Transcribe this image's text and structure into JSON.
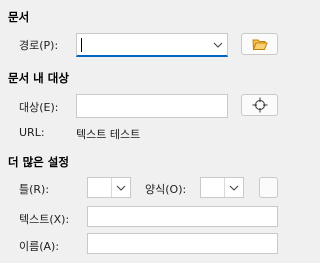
{
  "sections": {
    "document": "문서",
    "target_in_document": "문서 내 대상",
    "further_settings": "더 많은 설정"
  },
  "path": {
    "label": "경로(P):",
    "value": ""
  },
  "target": {
    "label": "대상(E):",
    "value": ""
  },
  "url": {
    "label": "URL:",
    "value": "텍스트 테스트"
  },
  "frame": {
    "label": "틀(R):",
    "value": ""
  },
  "form": {
    "label": "양식(O):",
    "value": ""
  },
  "text": {
    "label": "텍스트(X):",
    "value": ""
  },
  "name": {
    "label": "이름(A):",
    "value": ""
  },
  "colors": {
    "accent": "#0067c0",
    "folder": "#f0a020"
  }
}
